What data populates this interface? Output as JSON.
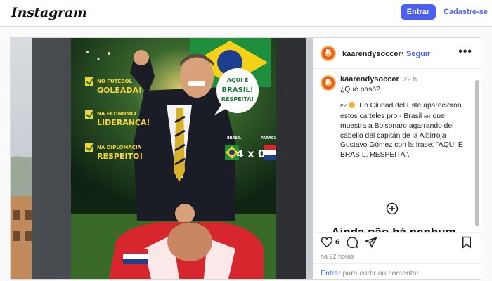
{
  "header": {
    "logo": "Instagram",
    "login_button": "Entrar",
    "signup_link": "Cadastre-se"
  },
  "post": {
    "username": "kaarendysoccer",
    "follow_label": "Seguir",
    "follow_separator": "•",
    "more_icon": "more-horizontal-icon",
    "caption": {
      "username": "kaarendysoccer",
      "time": "22 h",
      "line1": "¿Qué pasó?",
      "flag_prefix": "PY",
      "body": "En Ciudad del Este aparecieron estos carteles pro - Brasil",
      "flag_br": "BR",
      "body2": "que muestra a Bolsonaro agarrando del cabello del capitán de la Albirroja Gustavo Gómez con la frase: \"AQUÍ É BRASIL, RESPEITA\"."
    },
    "no_comments": "Ainda não há nenhum comentário.",
    "likes": "6",
    "time_ago": "há 22 horas",
    "login_prompt_link": "Entrar",
    "login_prompt_rest": " para curtir ou comentar."
  },
  "billboard": {
    "lines": [
      {
        "top": "NO FUTEBOL",
        "bottom": "GOLEADA!"
      },
      {
        "top": "NA ECONOMIA",
        "bottom": "LIDERANÇA!"
      },
      {
        "top": "NA DIPLOMACIA",
        "bottom": "RESPEITO!"
      }
    ],
    "speech_line1": "AQUI É",
    "speech_line2": "BRASIL!",
    "speech_line3": "RESPEITA!",
    "score_left_team": "BRASIL",
    "score_right_team": "PARAGUAI",
    "score": "4 x 0"
  },
  "colors": {
    "accent": "#4c5ff5",
    "muted": "#8e8e8e",
    "border": "#dbdbdb",
    "billboard_yellow": "#f5d33a",
    "billboard_green": "#1f7a3a"
  }
}
